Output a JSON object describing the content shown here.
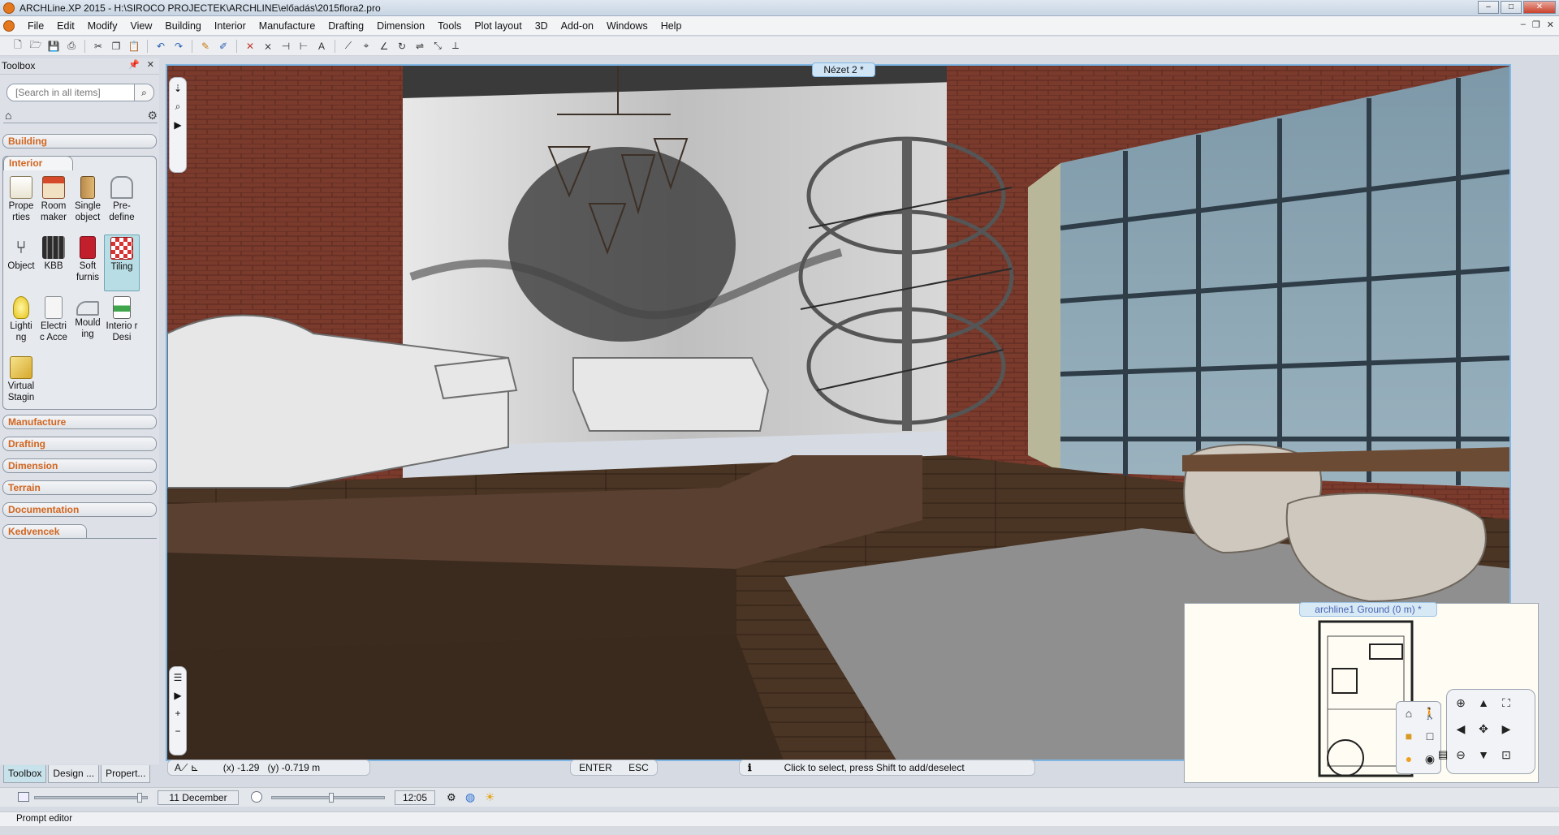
{
  "window": {
    "title": "ARCHLine.XP 2015 - H:\\SIROCO PROJECTEK\\ARCHLINE\\előadás\\2015flora2.pro",
    "min_label": "–",
    "max_label": "□",
    "close_label": "✕"
  },
  "menu": [
    "File",
    "Edit",
    "Modify",
    "View",
    "Building",
    "Interior",
    "Manufacture",
    "Drafting",
    "Dimension",
    "Tools",
    "Plot layout",
    "3D",
    "Add-on",
    "Windows",
    "Help"
  ],
  "toolbox": {
    "title": "Toolbox",
    "search_placeholder": "[Search in all items]",
    "categories_top": [
      "Building"
    ],
    "open_category": "Interior",
    "tools": [
      {
        "label": "Prope rties",
        "icon": "properties-icon"
      },
      {
        "label": "Room maker",
        "icon": "room-maker-icon"
      },
      {
        "label": "Single object",
        "icon": "single-object-icon"
      },
      {
        "label": "Pre- define",
        "icon": "predefine-icon"
      },
      {
        "label": "Object",
        "icon": "object-icon"
      },
      {
        "label": "KBB",
        "icon": "kbb-icon"
      },
      {
        "label": "Soft furnis",
        "icon": "soft-furnishing-icon"
      },
      {
        "label": "Tiling",
        "icon": "tiling-icon"
      },
      {
        "label": "Lighti ng",
        "icon": "lighting-icon"
      },
      {
        "label": "Electri c Acce",
        "icon": "electric-icon"
      },
      {
        "label": "Mould ing",
        "icon": "moulding-icon"
      },
      {
        "label": "Interio r Desi",
        "icon": "interior-design-icon"
      },
      {
        "label": "Virtual Stagin",
        "icon": "virtual-staging-icon"
      }
    ],
    "categories_bottom": [
      "Manufacture",
      "Drafting",
      "Dimension",
      "Terrain",
      "Documentation",
      "Kedvencek"
    ],
    "tabs": [
      "Toolbox",
      "Design ...",
      "Propert..."
    ]
  },
  "viewport": {
    "tab_label": "Nézet 2 *",
    "coords": {
      "x_label": "(x) -1.29",
      "y_label": "(y) -0.719 m"
    },
    "enter_label": "ENTER",
    "esc_label": "ESC",
    "hint": "Click to select, press Shift to add/deselect"
  },
  "minimap": {
    "tab_label": "archline1 Ground (0 m) *"
  },
  "datebar": {
    "date": "11 December",
    "time": "12:05"
  },
  "prompt": {
    "label": "Prompt editor"
  },
  "colors": {
    "accent": "#d2651e",
    "view_border": "#7fb6e3",
    "brick": "#7a3a2c",
    "floor": "#4a3424"
  }
}
